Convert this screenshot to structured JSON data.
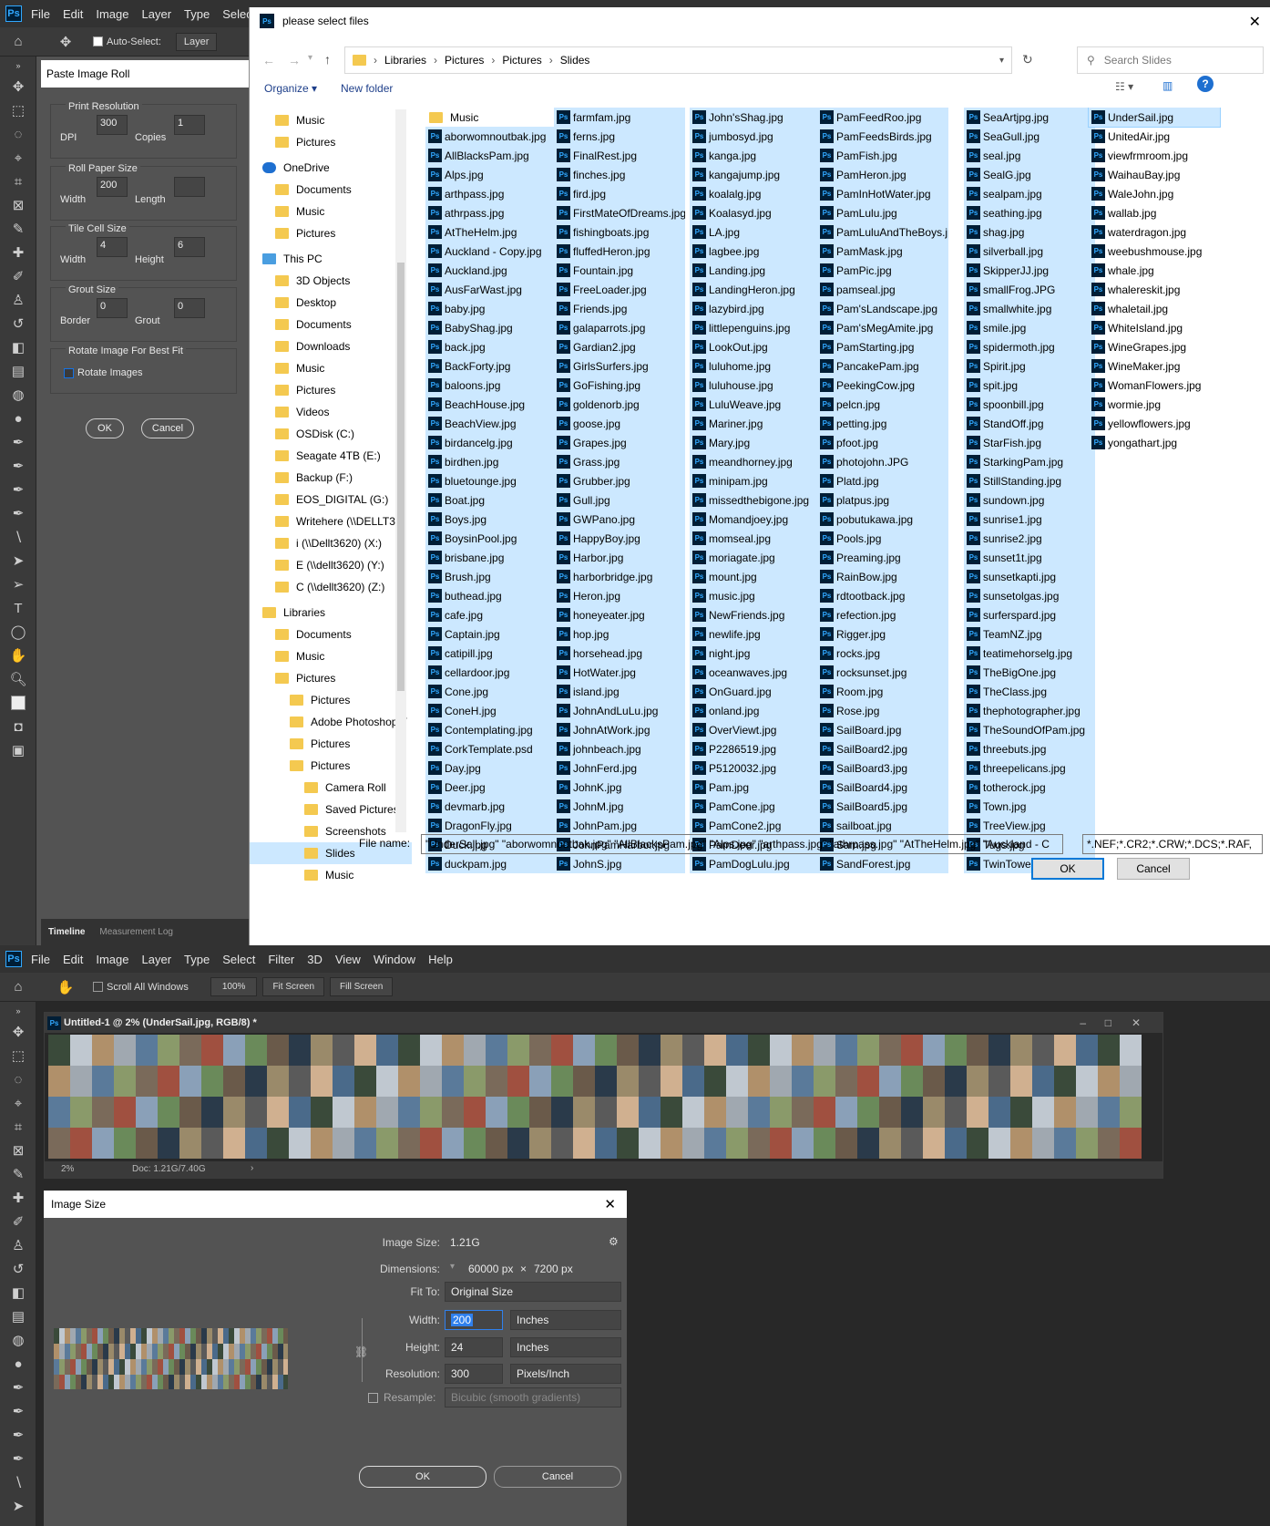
{
  "app": {
    "menu": [
      "File",
      "Edit",
      "Image",
      "Layer",
      "Type",
      "Select",
      "Fi"
    ],
    "auto_select": "Auto-Select:",
    "layer_opt": "Layer"
  },
  "roll": {
    "title": "Paste Image Roll",
    "g1": {
      "title": "Print Resolution",
      "l1": "DPI",
      "v1": "300",
      "l2": "Copies",
      "v2": "1"
    },
    "g2": {
      "title": "Roll Paper Size",
      "l1": "Width",
      "v1": "200",
      "l2": "Length",
      "v2": ""
    },
    "g3": {
      "title": "Tile Cell Size",
      "l1": "Width",
      "v1": "4",
      "l2": "Height",
      "v2": "6"
    },
    "g4": {
      "title": "Grout Size",
      "l1": "Border",
      "v1": "0",
      "l2": "Grout",
      "v2": "0"
    },
    "g5": {
      "title": "Rotate Image For Best Fit",
      "l1": "Rotate Images"
    },
    "ok": "OK",
    "cancel": "Cancel"
  },
  "tabs": {
    "timeline": "Timeline",
    "measure": "Measurement Log"
  },
  "dialog": {
    "title": "please select files",
    "crumbs": [
      "Libraries",
      "Pictures",
      "Pictures",
      "Slides"
    ],
    "search": "Search Slides",
    "organize": "Organize ▾",
    "newfolder": "New folder",
    "nav": [
      {
        "t": "Music",
        "i": 1
      },
      {
        "t": "Pictures",
        "i": 1
      },
      {
        "t": "OneDrive",
        "i": 0
      },
      {
        "t": "Documents",
        "i": 1
      },
      {
        "t": "Music",
        "i": 1
      },
      {
        "t": "Pictures",
        "i": 1
      },
      {
        "t": "This PC",
        "i": 0
      },
      {
        "t": "3D Objects",
        "i": 1
      },
      {
        "t": "Desktop",
        "i": 1
      },
      {
        "t": "Documents",
        "i": 1
      },
      {
        "t": "Downloads",
        "i": 1
      },
      {
        "t": "Music",
        "i": 1
      },
      {
        "t": "Pictures",
        "i": 1
      },
      {
        "t": "Videos",
        "i": 1
      },
      {
        "t": "OSDisk (C:)",
        "i": 1
      },
      {
        "t": "Seagate 4TB (E:)",
        "i": 1
      },
      {
        "t": "Backup (F:)",
        "i": 1
      },
      {
        "t": "EOS_DIGITAL (G:)",
        "i": 1
      },
      {
        "t": "Writehere (\\\\DELLT36",
        "i": 1
      },
      {
        "t": "i (\\\\Dellt3620) (X:)",
        "i": 1
      },
      {
        "t": "E (\\\\dellt3620) (Y:)",
        "i": 1
      },
      {
        "t": "C (\\\\dellt3620) (Z:)",
        "i": 1
      },
      {
        "t": "Libraries",
        "i": 0
      },
      {
        "t": "Documents",
        "i": 1
      },
      {
        "t": "Music",
        "i": 1
      },
      {
        "t": "Pictures",
        "i": 1
      },
      {
        "t": "Pictures",
        "i": 2
      },
      {
        "t": "Adobe Photoshop T",
        "i": 2
      },
      {
        "t": "Pictures",
        "i": 2
      },
      {
        "t": "Pictures",
        "i": 2
      },
      {
        "t": "Camera Roll",
        "i": 3
      },
      {
        "t": "Saved Pictures",
        "i": 3
      },
      {
        "t": "Screenshots",
        "i": 3
      },
      {
        "t": "Slides",
        "i": 3
      },
      {
        "t": "Music",
        "i": 3
      }
    ],
    "cols": [
      [
        "Music",
        "aborwomnoutbak.jpg",
        "AllBlacksPam.jpg",
        "Alps.jpg",
        "arthpass.jpg",
        "athrpass.jpg",
        "AtTheHelm.jpg",
        "Auckland - Copy.jpg",
        "Auckland.jpg",
        "AusFarWast.jpg",
        "baby.jpg",
        "BabyShag.jpg",
        "back.jpg",
        "BackForty.jpg",
        "baloons.jpg",
        "BeachHouse.jpg",
        "BeachView.jpg",
        "birdancelg.jpg",
        "birdhen.jpg",
        "bluetounge.jpg",
        "Boat.jpg",
        "Boys.jpg",
        "BoysinPool.jpg",
        "brisbane.jpg",
        "Brush.jpg",
        "buthead.jpg",
        "cafe.jpg",
        "Captain.jpg",
        "catipill.jpg",
        "cellardoor.jpg",
        "Cone.jpg",
        "ConeH.jpg",
        "Contemplating.jpg",
        "CorkTemplate.psd",
        "Day.jpg",
        "Deer.jpg",
        "devmarb.jpg",
        "DragonFly.jpg",
        "Duck.jpg",
        "duckpam.jpg"
      ],
      [
        "farmfam.jpg",
        "ferns.jpg",
        "FinalRest.jpg",
        "finches.jpg",
        "fird.jpg",
        "FirstMateOfDreams.jpg",
        "fishingboats.jpg",
        "fluffedHeron.jpg",
        "Fountain.jpg",
        "FreeLoader.jpg",
        "Friends.jpg",
        "galaparrots.jpg",
        "Gardian2.jpg",
        "GirlsSurfers.jpg",
        "GoFishing.jpg",
        "goldenorb.jpg",
        "goose.jpg",
        "Grapes.jpg",
        "Grass.jpg",
        "Grubber.jpg",
        "Gull.jpg",
        "GWPano.jpg",
        "HappyBoy.jpg",
        "Harbor.jpg",
        "harborbridge.jpg",
        "Heron.jpg",
        "honeyeater.jpg",
        "hop.jpg",
        "horsehead.jpg",
        "HotWater.jpg",
        "island.jpg",
        "JohnAndLuLu.jpg",
        "JohnAtWork.jpg",
        "johnbeach.jpg",
        "JohnFerd.jpg",
        "JohnK.jpg",
        "JohnM.jpg",
        "JohnPam.jpg",
        "JohnPamHarbor.jpg",
        "JohnS.jpg"
      ],
      [
        "John'sShag.jpg",
        "jumbosyd.jpg",
        "kanga.jpg",
        "kangajump.jpg",
        "koalalg.jpg",
        "Koalasyd.jpg",
        "LA.jpg",
        "lagbee.jpg",
        "Landing.jpg",
        "LandingHeron.jpg",
        "lazybird.jpg",
        "littlepenguins.jpg",
        "LookOut.jpg",
        "luluhome.jpg",
        "luluhouse.jpg",
        "LuluWeave.jpg",
        "Mariner.jpg",
        "Mary.jpg",
        "meandhorney.jpg",
        "minipam.jpg",
        "missedthebigone.jpg",
        "Momandjoey.jpg",
        "momseal.jpg",
        "moriagate.jpg",
        "mount.jpg",
        "music.jpg",
        "NewFriends.jpg",
        "newlife.jpg",
        "night.jpg",
        "oceanwaves.jpg",
        "OnGuard.jpg",
        "onland.jpg",
        "OverViewt.jpg",
        "P2286519.jpg",
        "P5120032.jpg",
        "Pam.jpg",
        "PamCone.jpg",
        "PamCone2.jpg",
        "PamDeer.jpg",
        "PamDogLulu.jpg"
      ],
      [
        "PamFeedRoo.jpg",
        "PamFeedsBirds.jpg",
        "PamFish.jpg",
        "PamHeron.jpg",
        "PamInHotWater.jpg",
        "PamLulu.jpg",
        "PamLuluAndTheBoys.jpg",
        "PamMask.jpg",
        "PamPic.jpg",
        "pamseal.jpg",
        "Pam'sLandscape.jpg",
        "Pam'sMegAmite.jpg",
        "PamStarting.jpg",
        "PancakePam.jpg",
        "PeekingCow.jpg",
        "pelcn.jpg",
        "petting.jpg",
        "pfoot.jpg",
        "photojohn.JPG",
        "Platd.jpg",
        "platpus.jpg",
        "pobutukawa.jpg",
        "Pools.jpg",
        "Preaming.jpg",
        "RainBow.jpg",
        "rdtootback.jpg",
        "refection.jpg",
        "Rigger.jpg",
        "rocks.jpg",
        "rocksunset.jpg",
        "Room.jpg",
        "Rose.jpg",
        "SailBoard.jpg",
        "SailBoard2.jpg",
        "SailBoard3.jpg",
        "SailBoard4.jpg",
        "SailBoard5.jpg",
        "sailboat.jpg",
        "Sam.jpg",
        "SandForest.jpg"
      ],
      [
        "SeaArtjpg.jpg",
        "SeaGull.jpg",
        "seal.jpg",
        "SealG.jpg",
        "sealpam.jpg",
        "seathing.jpg",
        "shag.jpg",
        "silverball.jpg",
        "SkipperJJ.jpg",
        "smallFrog.JPG",
        "smallwhite.jpg",
        "smile.jpg",
        "spidermoth.jpg",
        "Spirit.jpg",
        "spit.jpg",
        "spoonbill.jpg",
        "StandOff.jpg",
        "StarFish.jpg",
        "StarkingPam.jpg",
        "StillStanding.jpg",
        "sundown.jpg",
        "sunrise1.jpg",
        "sunrise2.jpg",
        "sunset1t.jpg",
        "sunsetkapti.jpg",
        "sunsetolgas.jpg",
        "surferspard.jpg",
        "TeamNZ.jpg",
        "teatimehorselg.jpg",
        "TheBigOne.jpg",
        "TheClass.jpg",
        "thephotographer.jpg",
        "TheSoundOfPam.jpg",
        "threebuts.jpg",
        "threepelicans.jpg",
        "totherock.jpg",
        "Town.jpg",
        "TreeView.jpg",
        "Tugs.jpg",
        "TwinTowers.jpg"
      ],
      [
        "UnderSail.jpg",
        "UnitedAir.jpg",
        "viewfrmroom.jpg",
        "WaihauBay.jpg",
        "WaleJohn.jpg",
        "wallab.jpg",
        "waterdragon.jpg",
        "weebushmouse.jpg",
        "whale.jpg",
        "whalereskit.jpg",
        "whaletail.jpg",
        "WhiteIsland.jpg",
        "WineGrapes.jpg",
        "WineMaker.jpg",
        "WomanFlowers.jpg",
        "wormie.jpg",
        "yellowflowers.jpg",
        "yongathart.jpg"
      ]
    ],
    "fname_label": "File name:",
    "fname": "\"UnderSail.jpg\" \"aborwomnoutbak.jpg\" \"AllBlacksPam.jpg\" \"Alps.jpg\" \"arthpass.jpg\" \"athrpass.jpg\" \"AtTheHelm.jpg\" \"Auckland - C",
    "ftype": "*.NEF;*.CR2;*.CRW;*.DCS;*.RAF,",
    "ok": "OK",
    "cancel": "Cancel"
  },
  "app2": {
    "menu": [
      "File",
      "Edit",
      "Image",
      "Layer",
      "Type",
      "Select",
      "Filter",
      "3D",
      "View",
      "Window",
      "Help"
    ],
    "scroll_all": "Scroll All Windows",
    "b100": "100%",
    "fit": "Fit Screen",
    "fill": "Fill Screen"
  },
  "doc": {
    "title": "Untitled-1 @ 2% (UnderSail.jpg, RGB/8) *",
    "zoom": "2%",
    "docsize": "Doc: 1.21G/7.40G"
  },
  "imgsize": {
    "title": "Image Size",
    "size_l": "Image Size:",
    "size_v": "1.21G",
    "dim_l": "Dimensions:",
    "dim_w": "60000 px",
    "x": "×",
    "dim_h": "7200 px",
    "fit_l": "Fit To:",
    "fit_v": "Original Size",
    "w_l": "Width:",
    "w_v": "200",
    "w_u": "Inches",
    "h_l": "Height:",
    "h_v": "24",
    "h_u": "Inches",
    "r_l": "Resolution:",
    "r_v": "300",
    "r_u": "Pixels/Inch",
    "rs_l": "Resample:",
    "rs_v": "Bicubic (smooth gradients)",
    "ok": "OK",
    "cancel": "Cancel"
  },
  "colors": {
    "ps_dark": "#535353",
    "accent": "#31a8ff",
    "select": "#cce8ff"
  }
}
